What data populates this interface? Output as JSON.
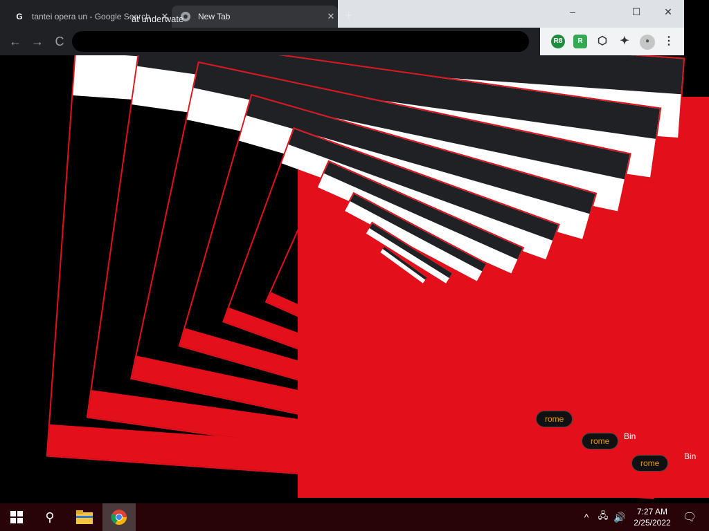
{
  "browser": {
    "tabs": [
      {
        "label": "tantei opera un - Google Search",
        "icon": "google-icon"
      },
      {
        "label": "New Tab",
        "icon": "chrome-icon"
      }
    ],
    "new_tab_symbol": "+",
    "window_controls": {
      "minimize": "–",
      "maximize": "☐",
      "close": "✕"
    },
    "omnibox_text": "ät underwate",
    "nav": {
      "back": "←",
      "forward": "→",
      "reload": "C"
    },
    "extensions": [
      {
        "name": "r8-icon",
        "label": "R8"
      },
      {
        "name": "green-extension-icon",
        "label": "R"
      },
      {
        "name": "shield-icon",
        "label": "⬡"
      },
      {
        "name": "puzzle-icon",
        "label": "✦"
      },
      {
        "name": "profile-icon",
        "label": "●"
      },
      {
        "name": "menu-icon",
        "label": "⋮"
      }
    ]
  },
  "desktop": {
    "recycle_bin_label": "Bin",
    "chrome_shortcut_label": "rome"
  },
  "taskbar": {
    "time": "7:27 AM",
    "date": "2/25/2022",
    "tray_chevron": "^",
    "search_symbol": "⚲",
    "network_symbol": "🖧",
    "volume_symbol": "🔊",
    "notifications_symbol": "🗨"
  },
  "colors": {
    "accent_red": "#e3101c",
    "taskbar_bg": "#280408",
    "chrome_dark": "#202124"
  }
}
